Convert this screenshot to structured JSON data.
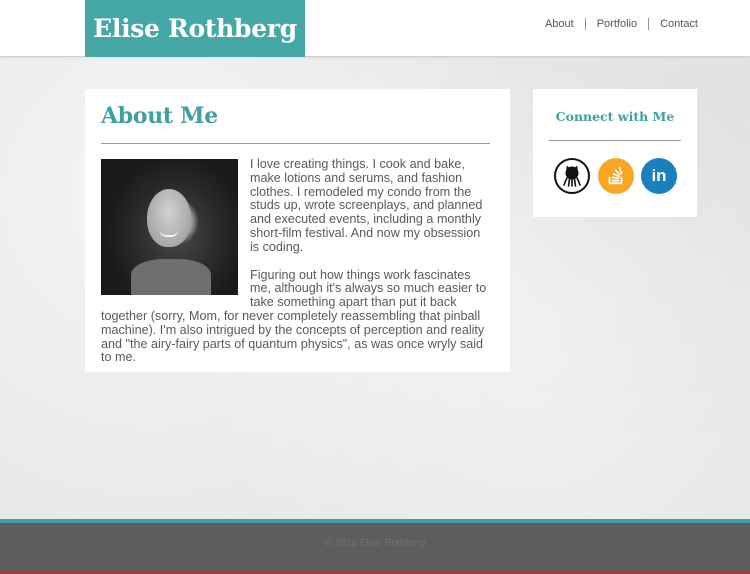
{
  "header": {
    "logo_text": "Elise Rothberg",
    "nav": [
      {
        "label": "About"
      },
      {
        "label": "Portfolio"
      },
      {
        "label": "Contact"
      }
    ]
  },
  "about": {
    "title": "About Me",
    "paragraphs": [
      "I love creating things. I cook and bake, make lotions and serums, and fashion clothes. I remodeled my condo from the studs up, wrote screenplays, and planned and executed events, including a monthly short-film festival. And now my obsession is coding.",
      "Figuring out how things work fascinates me, although it's always so much easier to take something apart than put it back together (sorry, Mom, for never completely reassembling that pinball machine). I'm also intrigued by the concepts of perception and reality and \"the airy-fairy parts of quantum physics\", as was once wryly said to me."
    ]
  },
  "connect": {
    "title": "Connect with Me",
    "icons": [
      {
        "name": "github-icon"
      },
      {
        "name": "stackoverflow-icon"
      },
      {
        "name": "linkedin-icon",
        "glyph": "in"
      }
    ]
  },
  "footer": {
    "text": "© 2016 Elise Rothberg"
  },
  "colors": {
    "accent": "#45a8a6",
    "footer_bg": "#5d5d5d",
    "page_bg": "#e6e6e6"
  }
}
